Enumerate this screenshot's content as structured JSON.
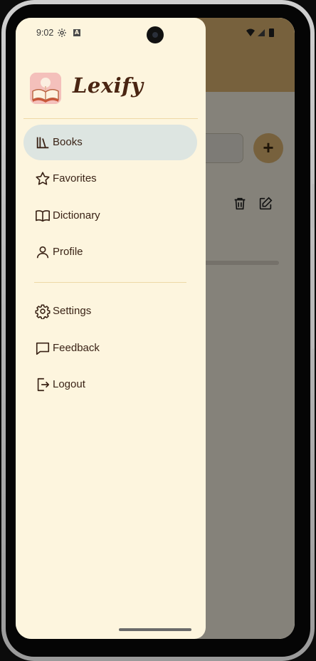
{
  "status_bar": {
    "time": "9:02",
    "badge": "A"
  },
  "app": {
    "name": "Lexify"
  },
  "background": {
    "fab_label": "+"
  },
  "nav": {
    "primary": [
      {
        "label": "Books",
        "icon": "library-icon",
        "active": true
      },
      {
        "label": "Favorites",
        "icon": "star-icon"
      },
      {
        "label": "Dictionary",
        "icon": "open-book-icon"
      },
      {
        "label": "Profile",
        "icon": "person-icon"
      }
    ],
    "secondary": [
      {
        "label": "Settings",
        "icon": "gear-icon"
      },
      {
        "label": "Feedback",
        "icon": "chat-bubble-icon"
      },
      {
        "label": "Logout",
        "icon": "logout-icon"
      }
    ]
  },
  "colors": {
    "drawer_bg": "#fdf5de",
    "active_item_bg": "#dde5e1",
    "accent": "#e0b873",
    "text": "#3a2316",
    "brand_text": "#4a2512"
  }
}
